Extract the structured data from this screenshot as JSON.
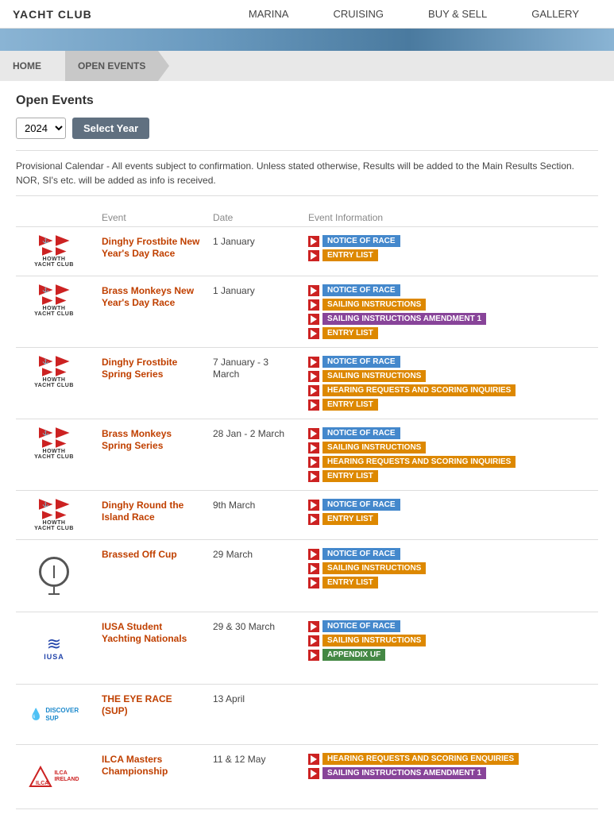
{
  "header": {
    "logo": "YACHT CLUB",
    "nav": [
      {
        "label": "MARINA",
        "name": "nav-marina"
      },
      {
        "label": "CRUISING",
        "name": "nav-cruising"
      },
      {
        "label": "BUY & SELL",
        "name": "nav-buy-sell"
      },
      {
        "label": "GALLERY",
        "name": "nav-gallery"
      }
    ]
  },
  "breadcrumb": {
    "home": "HOME",
    "current": "OPEN EVENTS"
  },
  "main": {
    "title": "Open Events",
    "year_value": "2024",
    "select_year_label": "Select Year",
    "notice": "Provisional Calendar - All events subject to confirmation. Unless stated otherwise, Results will be added to the Main Results Section. NOR, SI's etc. will be added as info is received."
  },
  "table": {
    "headers": [
      "",
      "Event",
      "Date",
      "Event Information"
    ],
    "rows": [
      {
        "logo_type": "hyc",
        "event": "Dinghy Frostbite New Year's Day Race",
        "date": "1 January",
        "badges": [
          {
            "label": "NOTICE OF RACE",
            "color": "blue"
          },
          {
            "label": "ENTRY LIST",
            "color": "orange"
          }
        ]
      },
      {
        "logo_type": "hyc",
        "event": "Brass Monkeys New Year's Day Race",
        "date": "1 January",
        "badges": [
          {
            "label": "NOTICE OF RACE",
            "color": "blue"
          },
          {
            "label": "SAILING INSTRUCTIONS",
            "color": "orange"
          },
          {
            "label": "SAILING INSTRUCTIONS AMENDMENT 1",
            "color": "purple"
          },
          {
            "label": "ENTRY LIST",
            "color": "orange"
          }
        ]
      },
      {
        "logo_type": "hyc",
        "event": "Dinghy Frostbite Spring Series",
        "date": "7 January - 3 March",
        "badges": [
          {
            "label": "NOTICE OF RACE",
            "color": "blue"
          },
          {
            "label": "SAILING INSTRUCTIONS",
            "color": "orange"
          },
          {
            "label": "HEARING REQUESTS AND SCORING INQUIRIES",
            "color": "orange"
          },
          {
            "label": "ENTRY LIST",
            "color": "orange"
          }
        ]
      },
      {
        "logo_type": "hyc",
        "event": "Brass Monkeys Spring Series",
        "date": "28 Jan - 2 March",
        "badges": [
          {
            "label": "NOTICE OF RACE",
            "color": "blue"
          },
          {
            "label": "SAILING INSTRUCTIONS",
            "color": "orange"
          },
          {
            "label": "HEARING REQUESTS AND SCORING INQUIRIES",
            "color": "orange"
          },
          {
            "label": "ENTRY LIST",
            "color": "orange"
          }
        ]
      },
      {
        "logo_type": "hyc",
        "event": "Dinghy Round the Island Race",
        "date": "9th March",
        "badges": [
          {
            "label": "NOTICE OF RACE",
            "color": "blue"
          },
          {
            "label": "ENTRY LIST",
            "color": "orange"
          }
        ]
      },
      {
        "logo_type": "brassed",
        "event": "Brassed Off Cup",
        "date": "29 March",
        "badges": [
          {
            "label": "NOTICE OF RACE",
            "color": "blue"
          },
          {
            "label": "SAILING INSTRUCTIONS",
            "color": "orange"
          },
          {
            "label": "ENTRY LIST",
            "color": "orange"
          }
        ]
      },
      {
        "logo_type": "iusa",
        "event": "IUSA Student Yachting Nationals",
        "date": "29 & 30 March",
        "badges": [
          {
            "label": "NOTICE OF RACE",
            "color": "blue"
          },
          {
            "label": "SAILING INSTRUCTIONS",
            "color": "orange"
          },
          {
            "label": "APPENDIX UF",
            "color": "green"
          }
        ]
      },
      {
        "logo_type": "sup",
        "event": "THE EYE RACE (SUP)",
        "date": "13 April",
        "badges": []
      },
      {
        "logo_type": "ilca",
        "event": "ILCA Masters Championship",
        "date": "11 & 12 May",
        "badges": [
          {
            "label": "HEARING REQUESTS AND SCORING ENQUIRIES",
            "color": "orange"
          },
          {
            "label": "SAILING INSTRUCTIONS AMENDMENT 1",
            "color": "purple"
          }
        ]
      }
    ]
  }
}
